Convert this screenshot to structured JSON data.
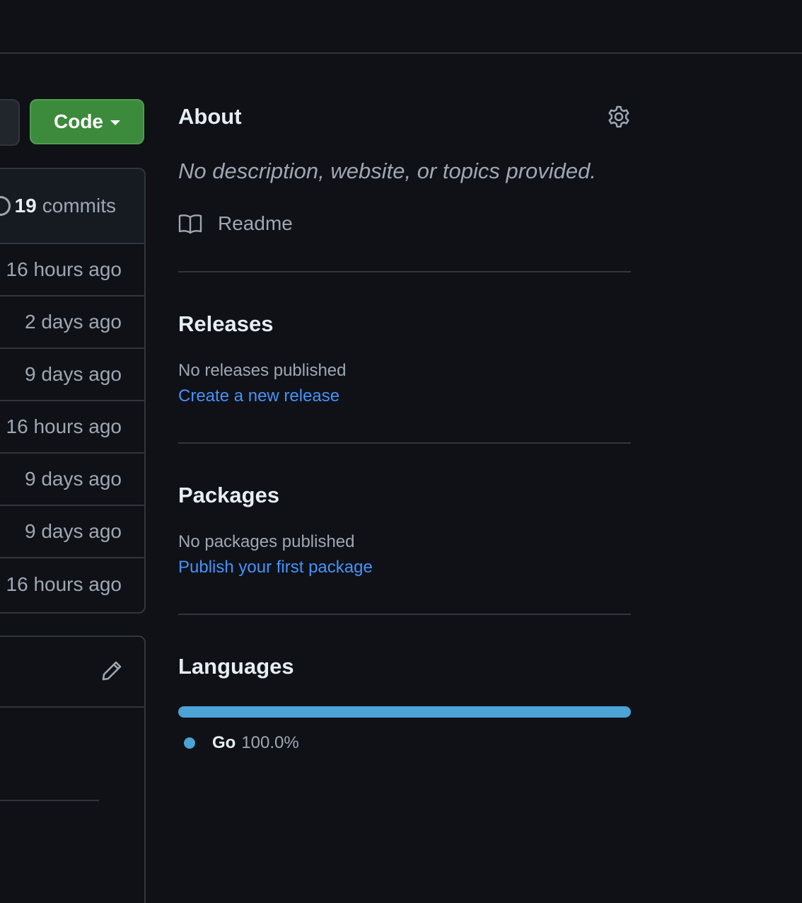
{
  "header": {},
  "left": {
    "code_button_label": "Code",
    "commits_count": "19",
    "commits_label": "commits",
    "file_rows": [
      {
        "time": "16 hours ago"
      },
      {
        "time": "2 days ago"
      },
      {
        "time": "9 days ago"
      },
      {
        "time": "16 hours ago"
      },
      {
        "time": "9 days ago"
      },
      {
        "time": "9 days ago"
      },
      {
        "time": "16 hours ago"
      }
    ]
  },
  "about": {
    "title": "About",
    "description": "No description, website, or topics provided.",
    "readme_label": "Readme"
  },
  "releases": {
    "title": "Releases",
    "status": "No releases published",
    "link": "Create a new release"
  },
  "packages": {
    "title": "Packages",
    "status": "No packages published",
    "link": "Publish your first package"
  },
  "languages": {
    "title": "Languages",
    "items": [
      {
        "name": "Go",
        "percent": "100.0%",
        "share": 1.0,
        "color": "#4ba3d6"
      }
    ]
  },
  "colors": {
    "background": "#0f1117",
    "border": "#30363d",
    "primary_button": "#3c8a3c",
    "link": "#4493f8",
    "muted_text": "#9ea7b3"
  },
  "icons": [
    "gear-icon",
    "book-icon",
    "pencil-icon",
    "caret-down-icon",
    "commits-icon"
  ]
}
